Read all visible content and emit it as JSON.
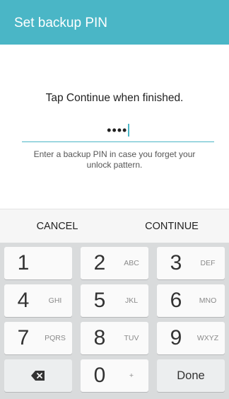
{
  "app_bar": {
    "title": "Set backup PIN"
  },
  "content": {
    "prompt": "Tap Continue when finished.",
    "pin_value": "••••",
    "helper": "Enter a backup PIN in case you forget your unlock pattern."
  },
  "actions": {
    "cancel_label": "CANCEL",
    "continue_label": "CONTINUE"
  },
  "keyboard": {
    "keys": [
      {
        "digit": "1",
        "letters": ""
      },
      {
        "digit": "2",
        "letters": "ABC"
      },
      {
        "digit": "3",
        "letters": "DEF"
      },
      {
        "digit": "4",
        "letters": "GHI"
      },
      {
        "digit": "5",
        "letters": "JKL"
      },
      {
        "digit": "6",
        "letters": "MNO"
      },
      {
        "digit": "7",
        "letters": "PQRS"
      },
      {
        "digit": "8",
        "letters": "TUV"
      },
      {
        "digit": "9",
        "letters": "WXYZ"
      },
      {
        "digit": "0",
        "letters": "+"
      }
    ],
    "done_label": "Done",
    "backspace_icon": "backspace-icon"
  },
  "colors": {
    "accent": "#4ab6c6",
    "keyboard_bg": "#d9dbdc",
    "key_bg": "#fafafa"
  }
}
